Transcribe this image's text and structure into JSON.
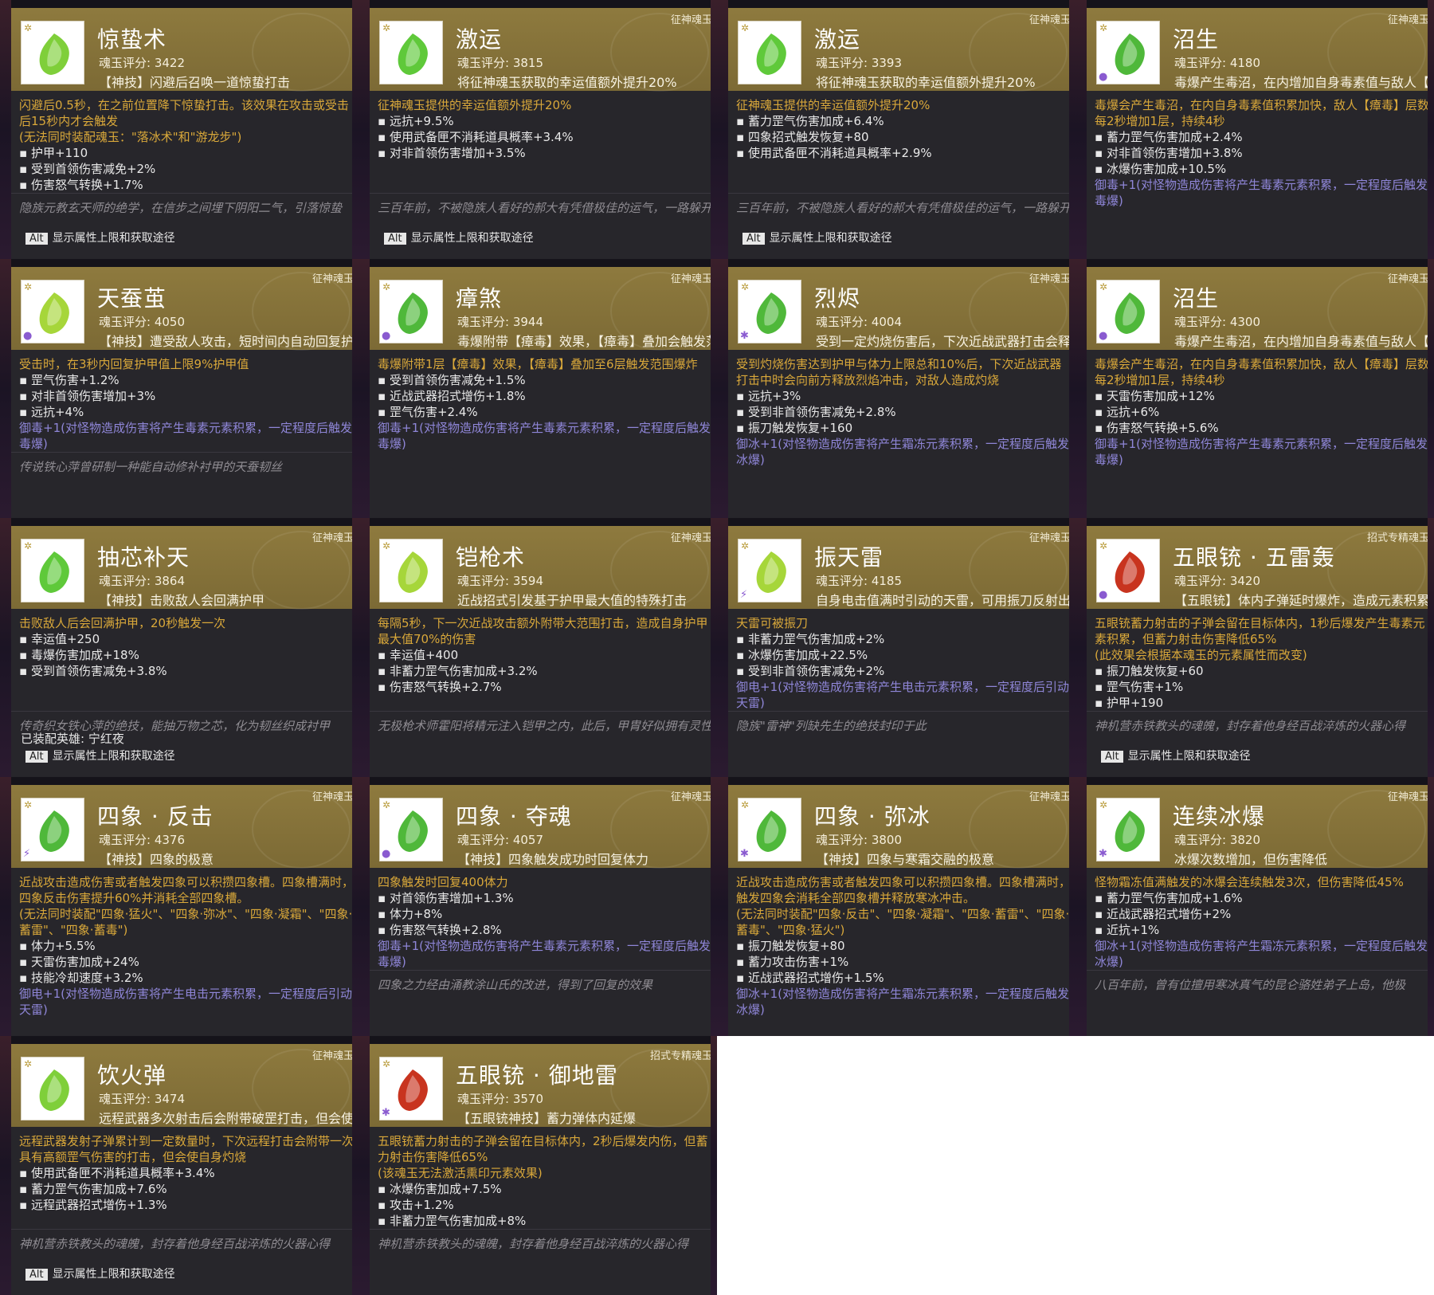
{
  "colors": {
    "header_gold": "#857239",
    "panel": "#27262b",
    "accent_orange": "#d9a83a",
    "accent_purple": "#8f86d8",
    "flavor_gray": "#8f8c92"
  },
  "cards": [
    {
      "name": "惊蛰术",
      "tag": "",
      "score": "魂玉评分: 3422",
      "skill": "【神技】闪避后召唤一道惊蛰打击",
      "gem": "#7fcf3a",
      "elem": "",
      "orange": [
        "闪避后0.5秒，在之前位置降下惊蛰打击。该效果在攻击或受击后15秒内才会触发",
        "(无法同时装配魂玉：\"落冰术\"和\"游龙步\")"
      ],
      "stats": [
        "护甲+110",
        "受到首领伤害减免+2%",
        "伤害怒气转换+1.7%"
      ],
      "purple": [],
      "flavor": "隐族元教玄天师的绝学，在信步之间埋下阴阳二气，引落惊蛰",
      "foot": "显示属性上限和获取途径",
      "equip": ""
    },
    {
      "name": "激运",
      "tag": "征神魂玉",
      "score": "魂玉评分: 3815",
      "skill": "将征神魂玉获取的幸运值额外提升20%",
      "gem": "#5fc93a",
      "elem": "",
      "orange": [
        "征神魂玉提供的幸运值额外提升20%"
      ],
      "stats": [
        "远抗+9.5%",
        "使用武备匣不消耗道具概率+3.4%",
        "对非首领伤害增加+3.5%"
      ],
      "purple": [],
      "flavor": "三百年前，不被隐族人看好的郝大有凭借极佳的运气，一路躲开了几位强大的敌人，最后竟能走到苍狼王的面前",
      "foot": "显示属性上限和获取途径",
      "equip": ""
    },
    {
      "name": "激运",
      "tag": "征神魂玉",
      "score": "魂玉评分: 3393",
      "skill": "将征神魂玉获取的幸运值额外提升20%",
      "gem": "#5fc93a",
      "elem": "",
      "orange": [
        "征神魂玉提供的幸运值额外提升20%"
      ],
      "stats": [
        "蓄力罡气伤害加成+6.4%",
        "四象招式触发恢复+80",
        "使用武备匣不消耗道具概率+2.9%"
      ],
      "purple": [],
      "flavor": "三百年前，不被隐族人看好的郝大有凭借极佳的运气，一路躲开了几位强大的敌人，最后竟能走到苍狼王的面前",
      "foot": "显示属性上限和获取途径",
      "equip": ""
    },
    {
      "name": "沼生",
      "tag": "征神魂玉",
      "score": "魂玉评分: 4180",
      "skill": "毒爆产生毒沼，在内增加自身毒素值与敌人【瘴毒】层数",
      "gem": "#4fb83a",
      "elem": "●",
      "orange": [
        "毒爆会产生毒沼，在内自身毒素值积累加快，敌人【瘴毒】层数每2秒增加1层，持续4秒"
      ],
      "stats": [
        "蓄力罡气伤害加成+2.4%",
        "对非首领伤害增加+3.8%",
        "冰爆伤害加成+10.5%"
      ],
      "purple": [
        "御毒+1(对怪物造成伤害将产生毒素元素积累，一定程度后触发毒爆)"
      ],
      "flavor": "",
      "foot": "",
      "equip": ""
    },
    {
      "name": "天蚕茧",
      "tag": "征神魂玉",
      "score": "魂玉评分: 4050",
      "skill": "【神技】遭受敌人攻击，短时间内自动回复护甲值",
      "gem": "#a6d63a",
      "elem": "●",
      "orange": [
        "受击时，在3秒内回复护甲值上限9%护甲值"
      ],
      "stats": [
        "罡气伤害+1.2%",
        "对非首领伤害增加+3%",
        "远抗+4%"
      ],
      "purple": [
        "御毒+1(对怪物造成伤害将产生毒素元素积累，一定程度后触发毒爆)"
      ],
      "flavor": "传说铁心萍曾研制一种能自动修补衬甲的天蚕韧丝",
      "foot": "",
      "equip": ""
    },
    {
      "name": "瘴煞",
      "tag": "征神魂玉",
      "score": "魂玉评分: 3944",
      "skill": "毒爆附带【瘴毒】效果，【瘴毒】叠加会触发范围打击",
      "gem": "#4fb83a",
      "elem": "●",
      "orange": [
        "毒爆附带1层【瘴毒】效果，【瘴毒】叠加至6层触发范围爆炸"
      ],
      "stats": [
        "受到首领伤害减免+1.5%",
        "近战武器招式增伤+1.8%",
        "罡气伤害+2.4%"
      ],
      "purple": [
        "御毒+1(对怪物造成伤害将产生毒素元素积累，一定程度后触发毒爆)"
      ],
      "flavor": "",
      "foot": "",
      "equip": ""
    },
    {
      "name": "烈烬",
      "tag": "征神魂玉",
      "score": "魂玉评分: 4004",
      "skill": "受到一定灼烧伤害后，下次近战武器打击会释放烈焰",
      "gem": "#4fb83a",
      "elem": "✱",
      "orange": [
        "受到灼烧伤害达到护甲与体力上限总和10%后，下次近战武器打击中时会向前方释放烈焰冲击，对敌人造成灼烧"
      ],
      "stats": [
        "远抗+3%",
        "受到非首领伤害减免+2.8%",
        "振刀触发恢复+160"
      ],
      "purple": [
        "御冰+1(对怪物造成伤害将产生霜冻元素积累，一定程度后触发冰爆)"
      ],
      "flavor": "",
      "foot": "",
      "equip": ""
    },
    {
      "name": "沼生",
      "tag": "征神魂玉",
      "score": "魂玉评分: 4300",
      "skill": "毒爆产生毒沼，在内增加自身毒素值与敌人【瘴毒】层数",
      "gem": "#4fb83a",
      "elem": "●",
      "orange": [
        "毒爆会产生毒沼，在内自身毒素值积累加快，敌人【瘴毒】层数每2秒增加1层，持续4秒"
      ],
      "stats": [
        "天雷伤害加成+12%",
        "远抗+6%",
        "伤害怒气转换+5.6%"
      ],
      "purple": [
        "御毒+1(对怪物造成伤害将产生毒素元素积累，一定程度后触发毒爆)"
      ],
      "flavor": "",
      "foot": "",
      "equip": ""
    },
    {
      "name": "抽芯补天",
      "tag": "征神魂玉",
      "score": "魂玉评分: 3864",
      "skill": "【神技】击败敌人会回满护甲",
      "gem": "#5fc93a",
      "elem": "",
      "orange": [
        "击败敌人后会回满护甲，20秒触发一次"
      ],
      "stats": [
        "幸运值+250",
        "毒爆伤害加成+18%",
        "受到首领伤害减免+3.8%"
      ],
      "purple": [],
      "flavor": "传奇织女铁心萍的绝技，能抽万物之芯，化为韧丝织成衬甲",
      "foot": "显示属性上限和获取途径",
      "equip": "已装配英雄: 宁红夜"
    },
    {
      "name": "铠枪术",
      "tag": "征神魂玉",
      "score": "魂玉评分: 3594",
      "skill": "近战招式引发基于护甲最大值的特殊打击",
      "gem": "#a6d63a",
      "elem": "",
      "orange": [
        "每隔5秒，下一次近战攻击额外附带大范围打击，造成自身护甲最大值70%的伤害"
      ],
      "stats": [
        "幸运值+400",
        "非蓄力罡气伤害加成+3.2%",
        "伤害怒气转换+2.7%"
      ],
      "purple": [],
      "flavor": "无极枪术师霍阳将精元注入铠甲之内，此后，甲胄好似拥有灵性般助他屡战屡胜",
      "foot": "",
      "equip": ""
    },
    {
      "name": "振天雷",
      "tag": "征神魂玉",
      "score": "魂玉评分: 4185",
      "skill": "自身电击值满时引动的天雷，可用振刀反射出去",
      "gem": "#a6d63a",
      "elem": "⚡",
      "orange": [
        "天雷可被振刀"
      ],
      "stats": [
        "非蓄力罡气伤害加成+2%",
        "冰爆伤害加成+22.5%",
        "受到非首领伤害减免+2%"
      ],
      "purple": [
        "御电+1(对怪物造成伤害将产生电击元素积累，一定程度后引动天雷)"
      ],
      "flavor": "隐族\"雷神\"列缺先生的绝技封印于此",
      "foot": "",
      "equip": ""
    },
    {
      "name": "五眼铳 · 五雷轰",
      "tag": "招式专精魂玉",
      "score": "魂玉评分: 3420",
      "skill": "【五眼铳】体内子弹延时爆炸，造成元素积累",
      "gem": "#c8341f",
      "elem": "●",
      "orange": [
        "五眼铳蓄力射击的子弹会留在目标体内，1秒后爆发产生毒素元素积累，但蓄力射击伤害降低65%",
        "(此效果会根据本魂玉的元素属性而改变)"
      ],
      "stats": [
        "振刀触发恢复+60",
        "罡气伤害+1%",
        "护甲+190"
      ],
      "purple": [],
      "flavor": "神机营赤铁教头的魂魄，封存着他身经百战淬炼的火器心得",
      "foot": "显示属性上限和获取途径",
      "equip": ""
    },
    {
      "name": "四象 · 反击",
      "tag": "征神魂玉",
      "score": "魂玉评分: 4376",
      "skill": "【神技】四象的极意",
      "gem": "#4fb83a",
      "elem": "⚡",
      "orange": [
        "近战攻击造成伤害或者触发四象可以积攒四象槽。四象槽满时，四象反击伤害提升60%并消耗全部四象槽。",
        "(无法同时装配\"四象·猛火\"、\"四象·弥冰\"、\"四象·凝霜\"、\"四象·蓄雷\"、\"四象·蓄毒\")"
      ],
      "stats": [
        "体力+5.5%",
        "天雷伤害加成+24%",
        "技能冷却速度+3.2%"
      ],
      "purple": [
        "御电+1(对怪物造成伤害将产生电击元素积累，一定程度后引动天雷)"
      ],
      "flavor": "",
      "foot": "",
      "equip": ""
    },
    {
      "name": "四象 · 夺魂",
      "tag": "征神魂玉",
      "score": "魂玉评分: 4057",
      "skill": "【神技】四象触发成功时回复体力",
      "gem": "#4fb83a",
      "elem": "●",
      "orange": [
        "四象触发时回复400体力"
      ],
      "stats": [
        "对首领伤害增加+1.3%",
        "体力+8%",
        "伤害怒气转换+2.8%"
      ],
      "purple": [
        "御毒+1(对怪物造成伤害将产生毒素元素积累，一定程度后触发毒爆)"
      ],
      "flavor": "四象之力经由涌教涂山氏的改进，得到了回复的效果",
      "foot": "",
      "equip": ""
    },
    {
      "name": "四象 · 弥冰",
      "tag": "征神魂玉",
      "score": "魂玉评分: 3800",
      "skill": "【神技】四象与寒霜交融的极意",
      "gem": "#4fb83a",
      "elem": "✱",
      "orange": [
        "近战攻击造成伤害或者触发四象可以积攒四象槽。四象槽满时，触发四象会消耗全部四象槽并释放寒冰冲击。",
        "(无法同时装配\"四象·反击\"、\"四象·凝霜\"、\"四象·蓄雷\"、\"四象·蓄毒\"、\"四象·猛火\")"
      ],
      "stats": [
        "振刀触发恢复+80",
        "蓄力攻击伤害+1%",
        "近战武器招式增伤+1.5%"
      ],
      "purple": [
        "御冰+1(对怪物造成伤害将产生霜冻元素积累，一定程度后触发冰爆)"
      ],
      "flavor": "",
      "foot": "",
      "equip": ""
    },
    {
      "name": "连续冰爆",
      "tag": "征神魂玉",
      "score": "魂玉评分: 3820",
      "skill": "冰爆次数增加，但伤害降低",
      "gem": "#4fb83a",
      "elem": "✱",
      "orange": [
        "怪物霜冻值满触发的冰爆会连续触发3次，但伤害降低45%"
      ],
      "stats": [
        "蓄力罡气伤害加成+1.6%",
        "近战武器招式增伤+2%",
        "近抗+1%"
      ],
      "purple": [
        "御冰+1(对怪物造成伤害将产生霜冻元素积累，一定程度后触发冰爆)"
      ],
      "flavor": "八百年前，曾有位擅用寒冰真气的昆仑骆姓弟子上岛，他极",
      "foot": "",
      "equip": ""
    },
    {
      "name": "饮火弹",
      "tag": "征神魂玉",
      "score": "魂玉评分: 3474",
      "skill": "远程武器多次射击后会附带破罡打击，但会使自身灼烧",
      "gem": "#7fcf3a",
      "elem": "",
      "orange": [
        "远程武器发射子弹累计到一定数量时，下次远程打击会附带一次具有高额罡气伤害的打击，但会使自身灼烧"
      ],
      "stats": [
        "使用武备匣不消耗道具概率+3.4%",
        "蓄力罡气伤害加成+7.6%",
        "远程武器招式增伤+1.3%"
      ],
      "purple": [],
      "flavor": "神机营赤铁教头的魂魄，封存着他身经百战淬炼的火器心得",
      "foot": "显示属性上限和获取途径",
      "equip": ""
    },
    {
      "name": "五眼铳 · 御地雷",
      "tag": "招式专精魂玉",
      "score": "魂玉评分: 3570",
      "skill": "【五眼铳神技】蓄力弹体内延爆",
      "gem": "#c8341f",
      "elem": "✱",
      "orange": [
        "五眼铳蓄力射击的子弹会留在目标体内，2秒后爆发内伤，但蓄力射击伤害降低65%",
        "(该魂玉无法激活熏印元素效果)"
      ],
      "stats": [
        "冰爆伤害加成+7.5%",
        "攻击+1.2%",
        "非蓄力罡气伤害加成+8%"
      ],
      "purple": [],
      "flavor": "神机营赤铁教头的魂魄，封存着他身经百战淬炼的火器心得",
      "foot": "",
      "equip": ""
    }
  ]
}
